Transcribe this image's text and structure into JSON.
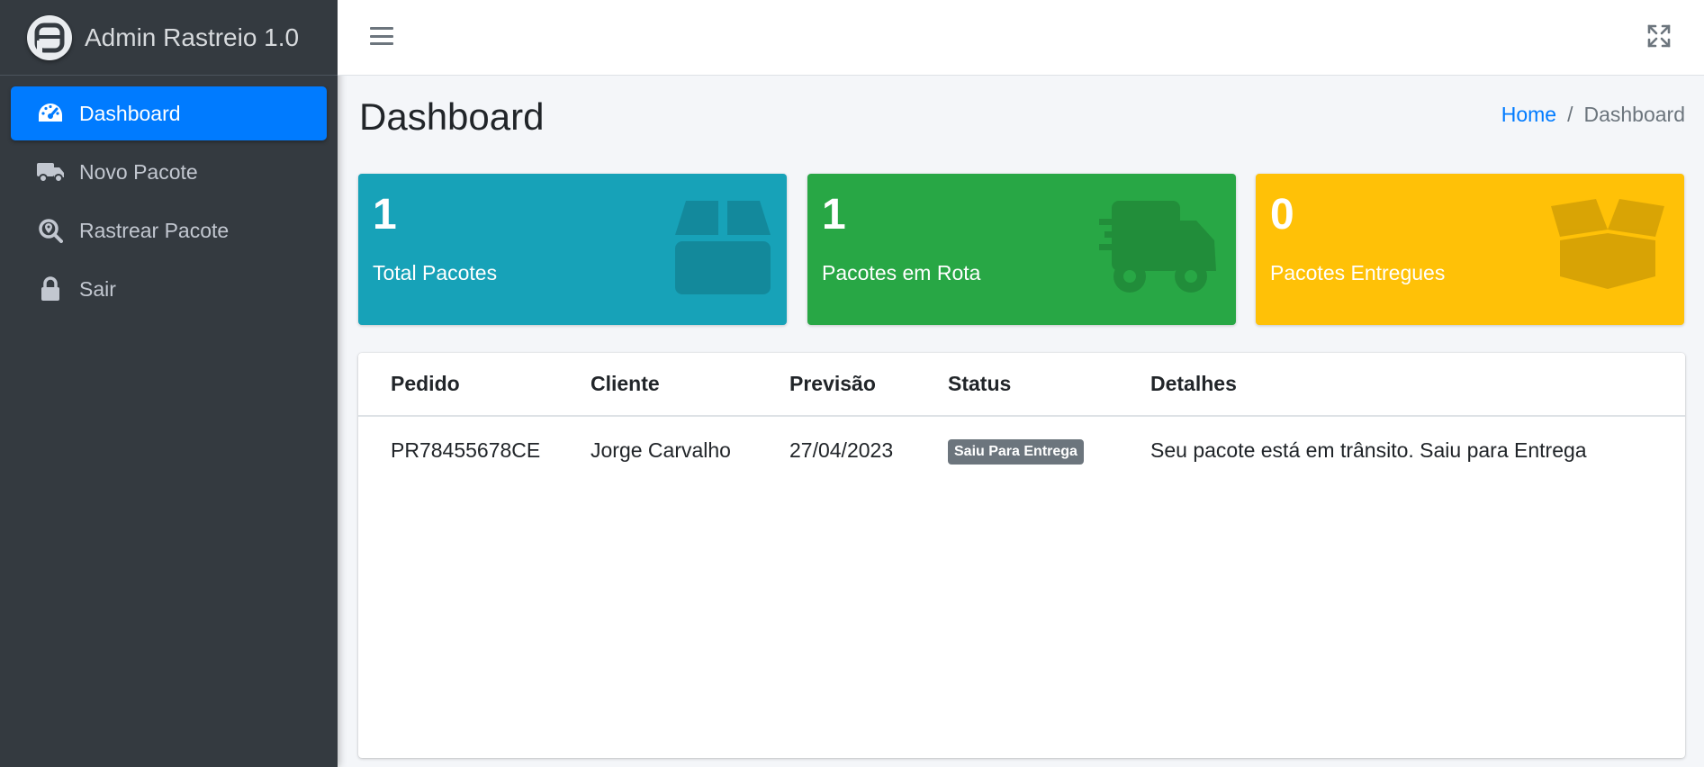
{
  "brand": {
    "title": "Admin Rastreio 1.0"
  },
  "sidebar": {
    "items": [
      {
        "label": "Dashboard",
        "icon": "tachometer-icon",
        "active": true
      },
      {
        "label": "Novo Pacote",
        "icon": "truck-icon",
        "active": false
      },
      {
        "label": "Rastrear Pacote",
        "icon": "search-location-icon",
        "active": false
      },
      {
        "label": "Sair",
        "icon": "lock-icon",
        "active": false
      }
    ]
  },
  "header": {
    "title": "Dashboard",
    "breadcrumb": {
      "home": "Home",
      "separator": "/",
      "current": "Dashboard"
    }
  },
  "stats": [
    {
      "value": "1",
      "label": "Total Pacotes",
      "icon": "box-icon",
      "color": "#17a2b8"
    },
    {
      "value": "1",
      "label": "Pacotes em Rota",
      "icon": "shipping-fast-icon",
      "color": "#28a745"
    },
    {
      "value": "0",
      "label": "Pacotes Entregues",
      "icon": "box-open-icon",
      "color": "#ffc107"
    }
  ],
  "table": {
    "columns": [
      "Pedido",
      "Cliente",
      "Previsão",
      "Status",
      "Detalhes"
    ],
    "rows": [
      {
        "pedido": "PR78455678CE",
        "cliente": "Jorge Carvalho",
        "previsao": "27/04/2023",
        "status": "Saiu Para Entrega",
        "detalhes": "Seu pacote está em trânsito. Saiu para Entrega"
      }
    ]
  },
  "colors": {
    "sidebar": "#343a40",
    "accent": "#007bff",
    "badge": "#6c757d"
  }
}
